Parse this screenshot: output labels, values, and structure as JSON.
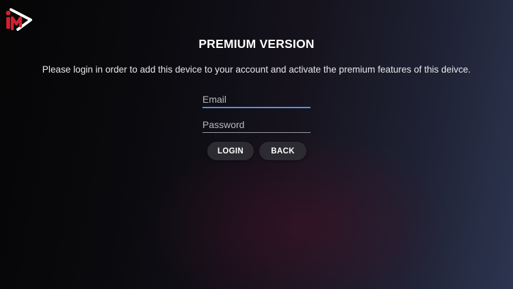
{
  "app": {
    "logo_icon": "im-play-logo-icon",
    "brand_color": "#d5202e"
  },
  "page": {
    "title": "PREMIUM VERSION",
    "message": "Please login in order to add this device to your account and activate the premium features of this deivce."
  },
  "form": {
    "email_placeholder": "Email",
    "email_value": "",
    "password_placeholder": "Password",
    "password_value": "",
    "focus_color": "#5b8fe8"
  },
  "buttons": {
    "login_label": "LOGIN",
    "back_label": "BACK"
  }
}
